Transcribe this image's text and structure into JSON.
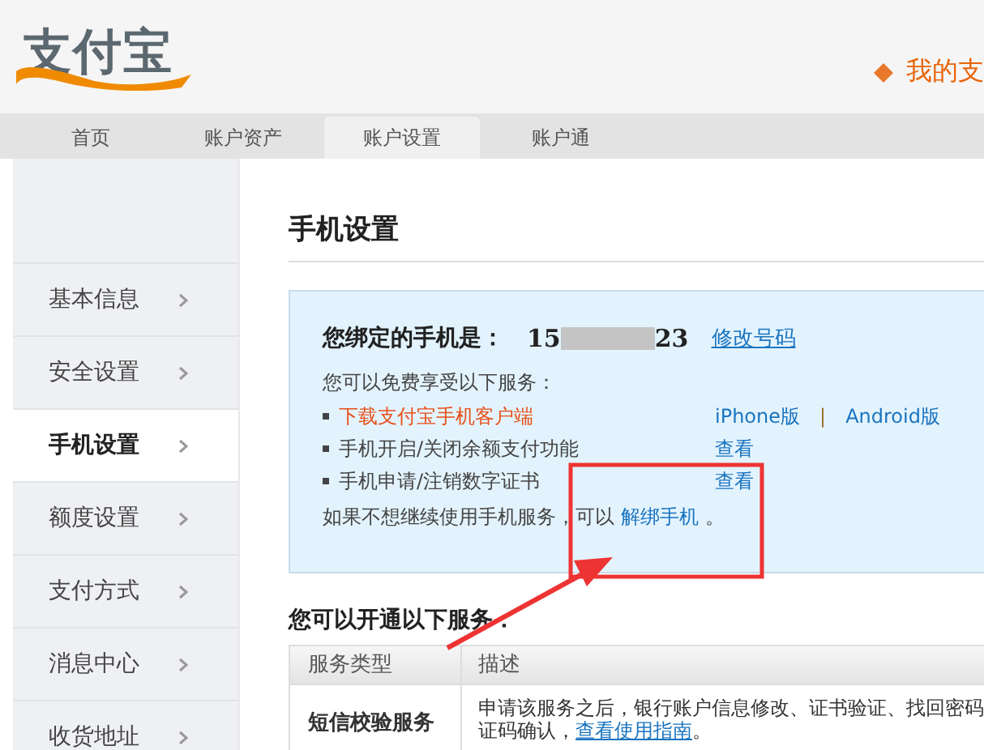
{
  "header": {
    "logo": "支付宝",
    "user_link": "我的支"
  },
  "nav": [
    {
      "label": "首页",
      "selected": false
    },
    {
      "label": "账户资产",
      "selected": false
    },
    {
      "label": "账户设置",
      "selected": true
    },
    {
      "label": "账户通",
      "selected": false
    }
  ],
  "sidebar": {
    "items": [
      {
        "label": "基本信息",
        "selected": false
      },
      {
        "label": "安全设置",
        "selected": false
      },
      {
        "label": "手机设置",
        "selected": true
      },
      {
        "label": "额度设置",
        "selected": false
      },
      {
        "label": "支付方式",
        "selected": false
      },
      {
        "label": "消息中心",
        "selected": false
      },
      {
        "label": "收货地址",
        "selected": false
      }
    ]
  },
  "page_title": "手机设置",
  "phone_box": {
    "label": "您绑定的手机是：",
    "phone_start": "15",
    "phone_end": "23",
    "change_link": "修改号码",
    "intro": "您可以免费享受以下服务：",
    "services": [
      {
        "text": "下载支付宝手机客户端",
        "kind": "highlight",
        "links": [
          "iPhone版",
          "Android版"
        ],
        "separator": "|"
      },
      {
        "text": "手机开启/关闭余额支付功能",
        "kind": "normal",
        "links": [
          "查看"
        ]
      },
      {
        "text": "手机申请/注销数字证书",
        "kind": "normal",
        "links": [
          "查看"
        ]
      }
    ],
    "unbind_text": "如果不想继续使用手机服务，可以",
    "unbind_link": "解绑手机",
    "unbind_end": "。"
  },
  "services_title": "您可以开通以下服务：",
  "table": {
    "columns": [
      "服务类型",
      "描述"
    ],
    "rows": [
      {
        "type": "短信校验服务",
        "description": "申请该服务之后，银行账户信息修改、证书验证、找回密码",
        "description_2": "证码确认，",
        "link": "查看使用指南",
        "link_end": "。"
      }
    ]
  }
}
